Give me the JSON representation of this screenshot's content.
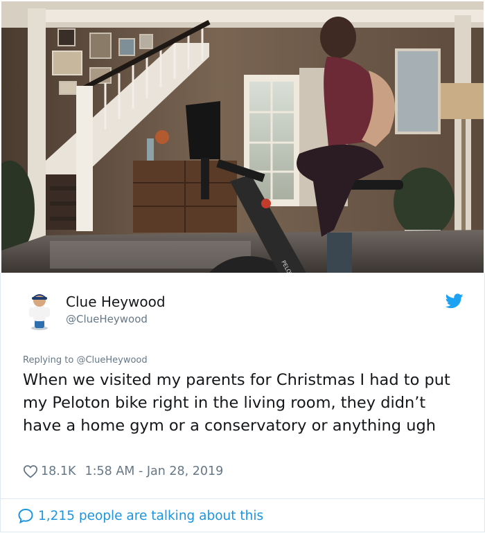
{
  "photo": {
    "alt_brand_text": "PELOTON"
  },
  "tweet": {
    "author_name": "Clue Heywood",
    "author_handle": "@ClueHeywood",
    "replying_prefix": "Replying to",
    "replying_handle": "@ClueHeywood",
    "text": "When we visited my parents for Christmas I had to put my Peloton bike right in the living room, they didn’t have a home gym or a conservatory or anything ugh",
    "likes": "18.1K",
    "timestamp": "1:58 AM - Jan 28, 2019",
    "talking": "1,215 people are talking about this"
  },
  "icons": {
    "avatar": "avatar-figurine",
    "brand": "twitter-bird-icon",
    "like": "heart-icon",
    "conversation": "speech-bubble-icon"
  },
  "colors": {
    "twitter_blue": "#1da1f2",
    "link_blue": "#1b95e0",
    "secondary_text": "#657786",
    "primary_text": "#14171a",
    "border": "#e1e8ed"
  }
}
